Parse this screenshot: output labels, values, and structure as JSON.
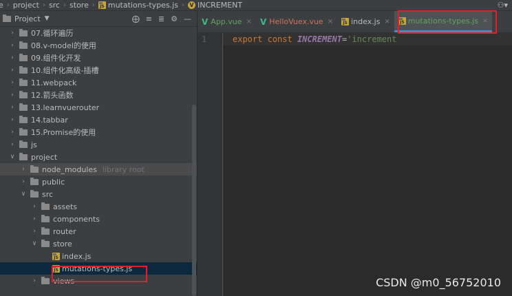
{
  "breadcrumb": [
    {
      "label": "e",
      "icon": "none"
    },
    {
      "label": "project",
      "icon": "none"
    },
    {
      "label": "src",
      "icon": "none"
    },
    {
      "label": "store",
      "icon": "none"
    },
    {
      "label": "mutations-types.js",
      "icon": "js-file-icon"
    },
    {
      "label": "INCREMENT",
      "icon": "vue-icon"
    }
  ],
  "panel": {
    "title": "Project",
    "tree": [
      {
        "label": "07.循环遍历",
        "indent": 0,
        "expanded": false,
        "type": "folder"
      },
      {
        "label": "08.v-model的使用",
        "indent": 0,
        "expanded": false,
        "type": "folder"
      },
      {
        "label": "09.组件化开发",
        "indent": 0,
        "expanded": false,
        "type": "folder"
      },
      {
        "label": "10.组件化高级-插槽",
        "indent": 0,
        "expanded": false,
        "type": "folder"
      },
      {
        "label": "11.webpack",
        "indent": 0,
        "expanded": false,
        "type": "folder"
      },
      {
        "label": "12.箭头函数",
        "indent": 0,
        "expanded": false,
        "type": "folder"
      },
      {
        "label": "13.learnvuerouter",
        "indent": 0,
        "expanded": false,
        "type": "folder"
      },
      {
        "label": "14.tabbar",
        "indent": 0,
        "expanded": false,
        "type": "folder"
      },
      {
        "label": "15.Promise的使用",
        "indent": 0,
        "expanded": false,
        "type": "folder"
      },
      {
        "label": "js",
        "indent": 0,
        "expanded": false,
        "type": "folder"
      },
      {
        "label": "project",
        "indent": 0,
        "expanded": true,
        "type": "folder"
      },
      {
        "label": "node_modules",
        "indent": 1,
        "expanded": false,
        "type": "folder",
        "note": "library root"
      },
      {
        "label": "public",
        "indent": 1,
        "expanded": false,
        "type": "folder"
      },
      {
        "label": "src",
        "indent": 1,
        "expanded": true,
        "type": "folder"
      },
      {
        "label": "assets",
        "indent": 2,
        "expanded": false,
        "type": "folder"
      },
      {
        "label": "components",
        "indent": 2,
        "expanded": false,
        "type": "folder"
      },
      {
        "label": "router",
        "indent": 2,
        "expanded": false,
        "type": "folder"
      },
      {
        "label": "store",
        "indent": 2,
        "expanded": true,
        "type": "folder"
      },
      {
        "label": "index.js",
        "indent": 3,
        "type": "js"
      },
      {
        "label": "mutations-types.js",
        "indent": 3,
        "type": "js"
      },
      {
        "label": "views",
        "indent": 2,
        "expanded": false,
        "type": "folder"
      }
    ]
  },
  "tabs": [
    {
      "label": "App.vue",
      "icon": "vue-icon",
      "color": "#62a262"
    },
    {
      "label": "HelloVuex.vue",
      "icon": "vue-icon",
      "color": "#d2735b"
    },
    {
      "label": "index.js",
      "icon": "js-file-icon",
      "color": "#bbbbbb"
    },
    {
      "label": "mutations-types.js",
      "icon": "js-file-icon",
      "color": "#62a262",
      "active": true
    }
  ],
  "editor": {
    "line_numbers": [
      "1"
    ],
    "code": {
      "keyword1": "export",
      "keyword2": "const",
      "name": "INCREMENT",
      "equals": "=",
      "string": "'increment"
    }
  },
  "watermark": "CSDN @m0_56752010",
  "colors": {
    "accent": "#4a88c7",
    "highlight_box": "#e0202a",
    "js_icon": "#c7a43a"
  }
}
